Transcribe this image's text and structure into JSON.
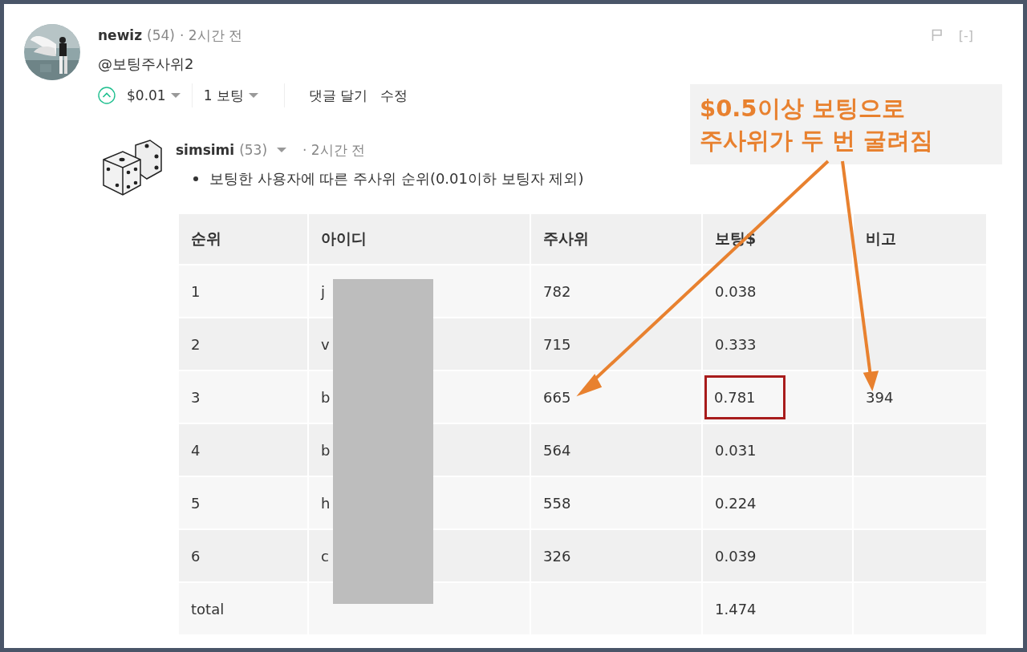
{
  "comment": {
    "author": "newiz",
    "reputation": "(54)",
    "time": "· 2시간 전",
    "body": "@보팅주사위2",
    "collapse": "[-]",
    "vote": {
      "upvoted": false,
      "amount": "$0.01",
      "count": "1 보팅"
    },
    "actions": [
      "댓글 달기",
      "수정"
    ]
  },
  "reply": {
    "author": "simsimi",
    "reputation": "(53)",
    "time": "· 2시간 전",
    "bullet": "보팅한 사용자에 따른 주사위 순위(0.01이하 보팅자 제외)",
    "table": {
      "columns": [
        "순위",
        "아이디",
        "주사위",
        "보팅$",
        "비고"
      ],
      "rows": [
        {
          "rank": "1",
          "id": "j",
          "dice": "782",
          "vote": "0.038",
          "highlighted": false
        },
        {
          "rank": "2",
          "id": "v",
          "dice": "715",
          "vote": "0.333",
          "highlighted": false
        },
        {
          "rank": "3",
          "id": "b",
          "dice": "665",
          "vote": "0.781",
          "note": "394",
          "highlighted": true
        },
        {
          "rank": "4",
          "id": "b",
          "dice": "564",
          "vote": "0.031",
          "highlighted": false
        },
        {
          "rank": "5",
          "id": "h",
          "dice": "558",
          "vote": "0.224",
          "highlighted": false
        },
        {
          "rank": "6",
          "id": "c",
          "dice": "326",
          "vote": "0.039",
          "highlighted": false
        },
        {
          "rank": "total",
          "vote": "1.474",
          "highlighted": false
        }
      ]
    }
  },
  "callout": {
    "text": "$0.5이상 보팅으로\n주사위가 두 번 굴려짐"
  }
}
